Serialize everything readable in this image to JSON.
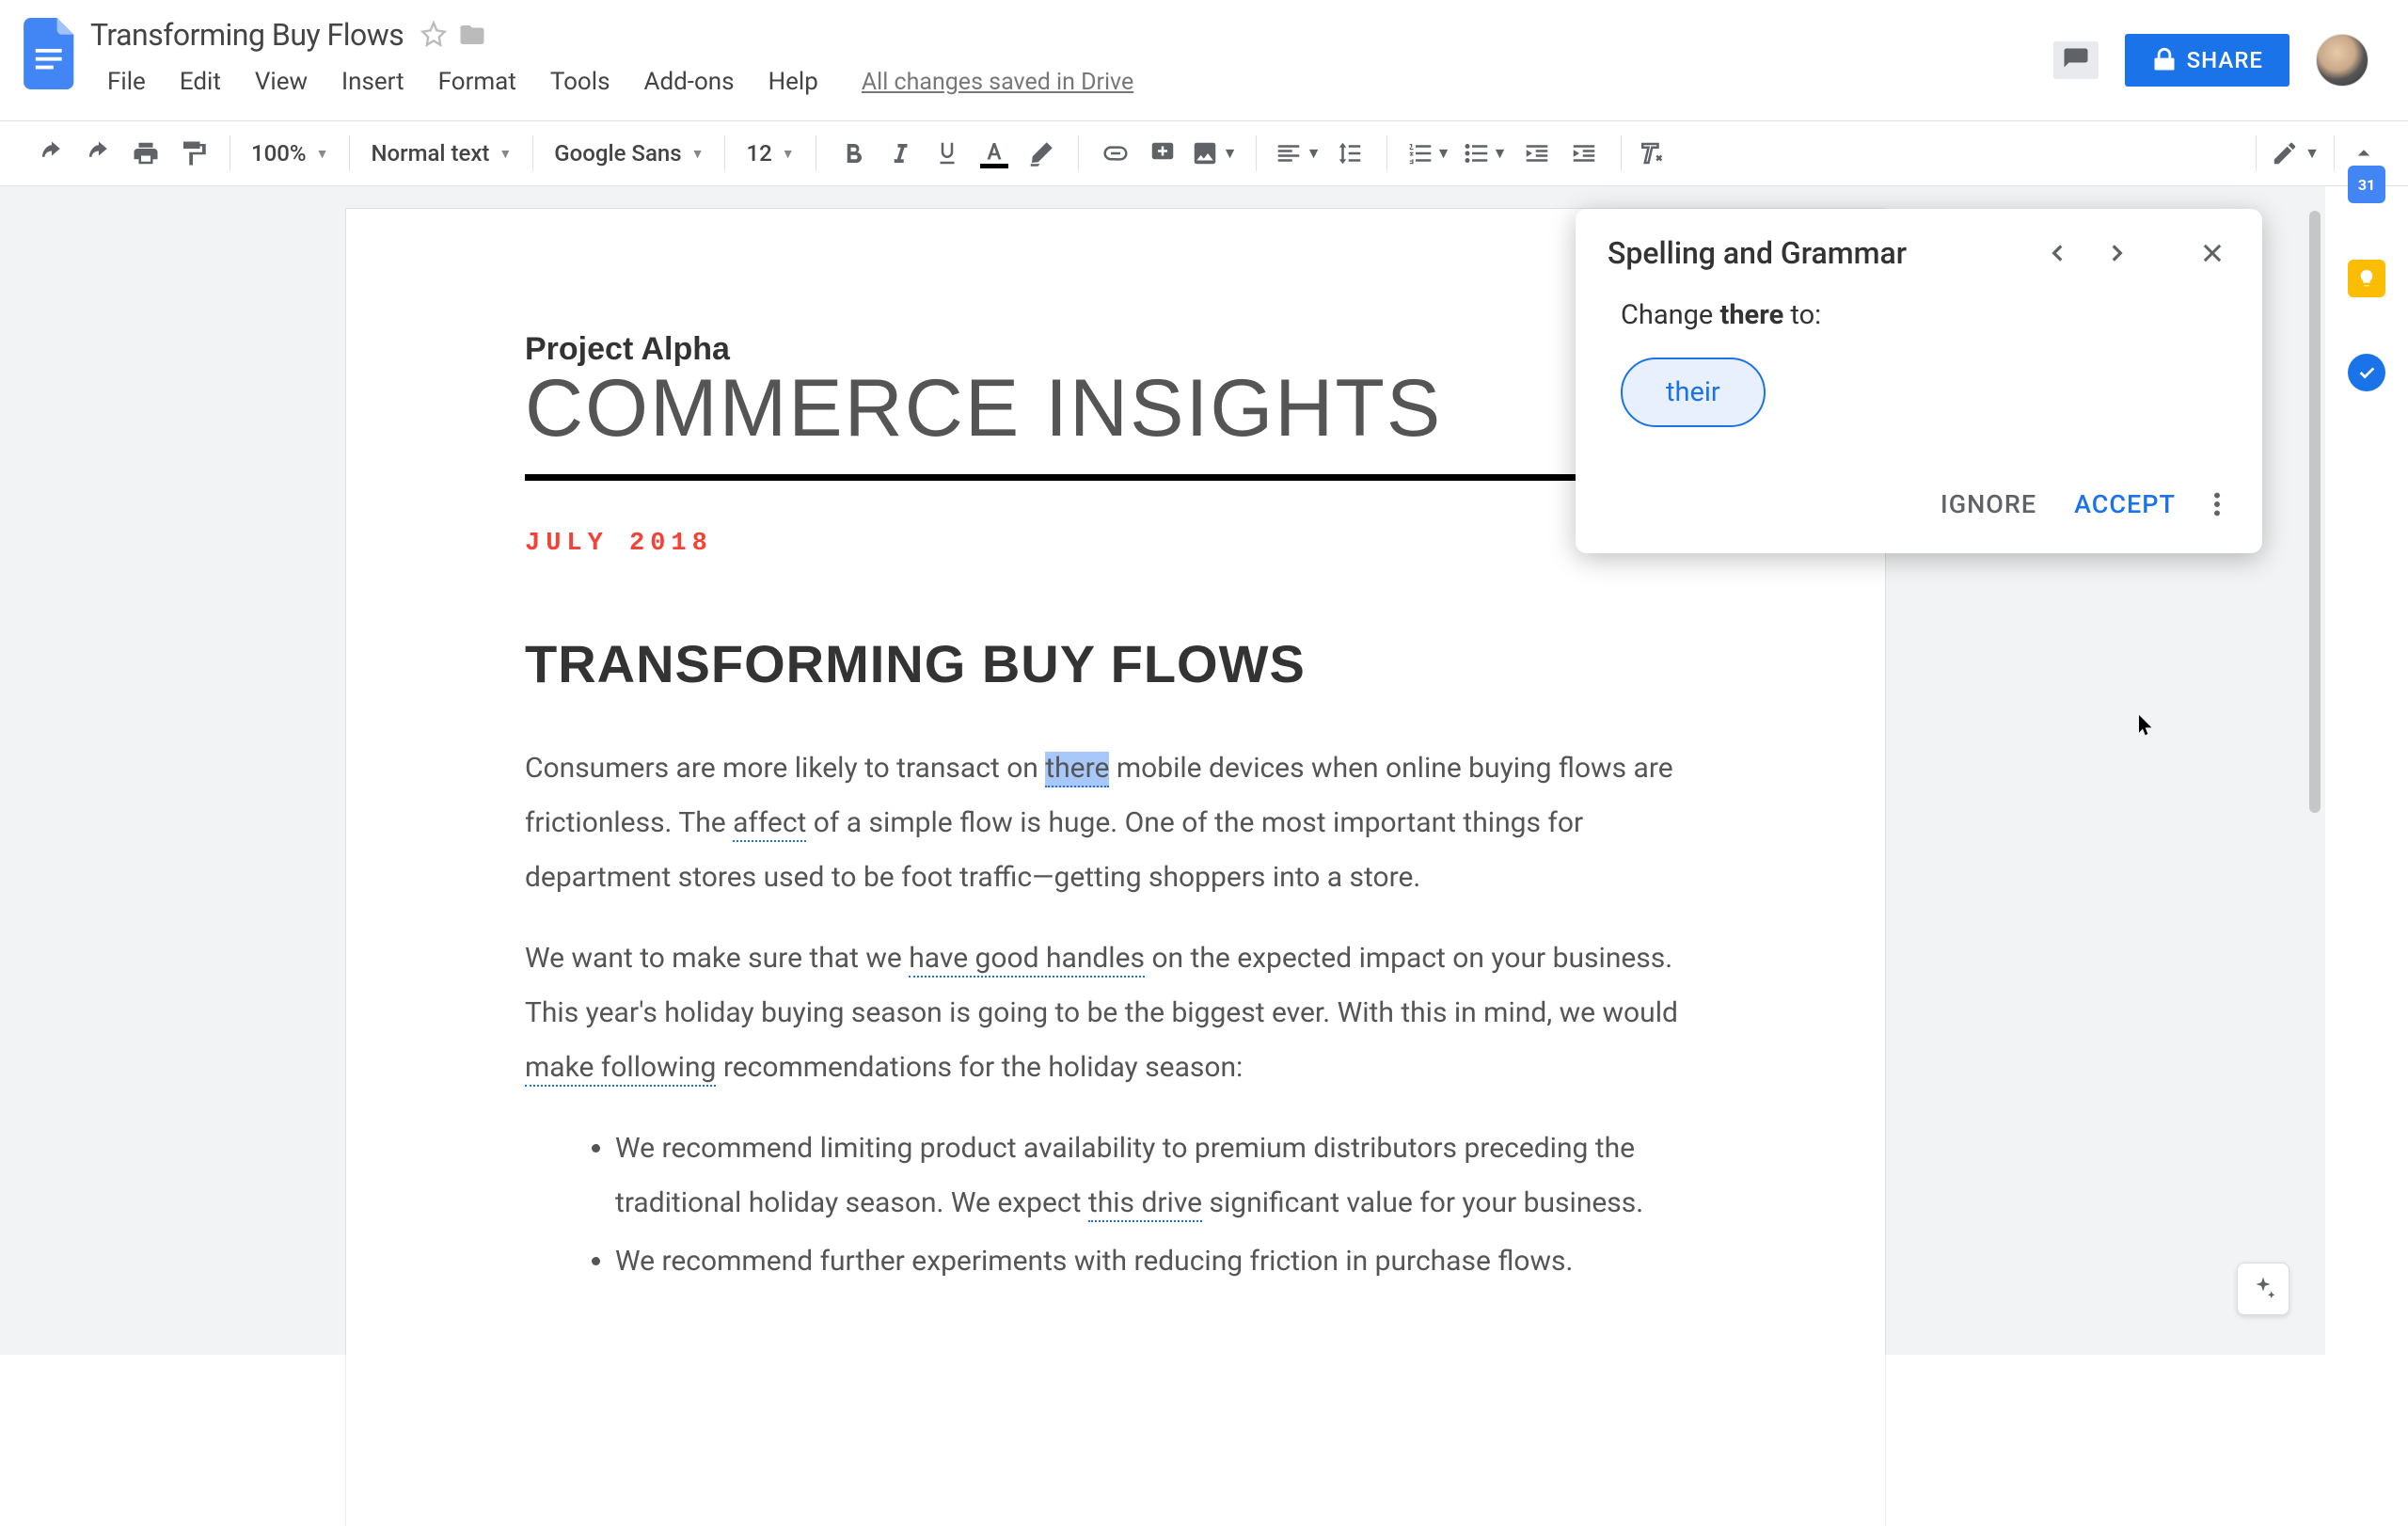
{
  "header": {
    "doc_title": "Transforming Buy Flows",
    "drive_status": "All changes saved in Drive",
    "menu": [
      "File",
      "Edit",
      "View",
      "Insert",
      "Format",
      "Tools",
      "Add-ons",
      "Help"
    ],
    "share_label": "SHARE"
  },
  "toolbar": {
    "zoom": "100%",
    "paragraph_style": "Normal text",
    "font": "Google Sans",
    "font_size": "12"
  },
  "document": {
    "project_label": "Project Alpha",
    "title": "COMMERCE INSIGHTS",
    "date_line": "JULY 2018",
    "subtitle": "TRANSFORMING BUY FLOWS",
    "p1_pre": "Consumers are more likely to transact on ",
    "p1_hl": "there",
    "p1_mid": " mobile devices when online buying flows are frictionless. The ",
    "p1_err1": "affect",
    "p1_post": " of a simple flow is huge. One of the most important things for department stores used to be foot traffic—getting shoppers into a store.",
    "p2_pre": "We want to make sure that we ",
    "p2_err1": "have good handles",
    "p2_mid": " on the expected impact on your business. This year's holiday buying season is going to be the biggest ever. With this in mind, we would ",
    "p2_err2": "make following",
    "p2_post": " recommendations for the holiday season:",
    "bullets": {
      "b1_pre": "We recommend limiting product availability to premium distributors preceding the traditional holiday season. We expect ",
      "b1_err": "this drive",
      "b1_post": " significant value for your business.",
      "b2": "We recommend further experiments with reducing friction in purchase flows."
    }
  },
  "sg_panel": {
    "title": "Spelling and Grammar",
    "change_label_pre": "Change ",
    "change_label_word": "there",
    "change_label_post": " to:",
    "suggestion": "their",
    "ignore": "IGNORE",
    "accept": "ACCEPT"
  },
  "side": {
    "calendar_day": "31"
  }
}
